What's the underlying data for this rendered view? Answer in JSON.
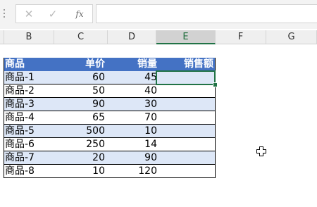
{
  "formula_bar": {
    "cancel_icon": "close-icon",
    "confirm_icon": "check-icon",
    "function_label": "fx",
    "cancel_glyph": "✕",
    "confirm_glyph": "✓",
    "formula_value": ""
  },
  "columns": [
    "B",
    "C",
    "D",
    "E",
    "F",
    "G"
  ],
  "selected_column": "E",
  "table": {
    "headers": [
      "商品",
      "单价",
      "销量",
      "销售额"
    ],
    "rows": [
      {
        "name": "商品-1",
        "price": "60",
        "qty": "45",
        "sales": ""
      },
      {
        "name": "商品-2",
        "price": "50",
        "qty": "40",
        "sales": ""
      },
      {
        "name": "商品-3",
        "price": "90",
        "qty": "30",
        "sales": ""
      },
      {
        "name": "商品-4",
        "price": "65",
        "qty": "70",
        "sales": ""
      },
      {
        "name": "商品-5",
        "price": "500",
        "qty": "10",
        "sales": ""
      },
      {
        "name": "商品-6",
        "price": "250",
        "qty": "14",
        "sales": ""
      },
      {
        "name": "商品-7",
        "price": "20",
        "qty": "90",
        "sales": ""
      },
      {
        "name": "商品-8",
        "price": "10",
        "qty": "120",
        "sales": ""
      }
    ]
  },
  "colors": {
    "header_fill": "#4472c4",
    "band_fill": "#dde7f7",
    "selection": "#217346"
  }
}
